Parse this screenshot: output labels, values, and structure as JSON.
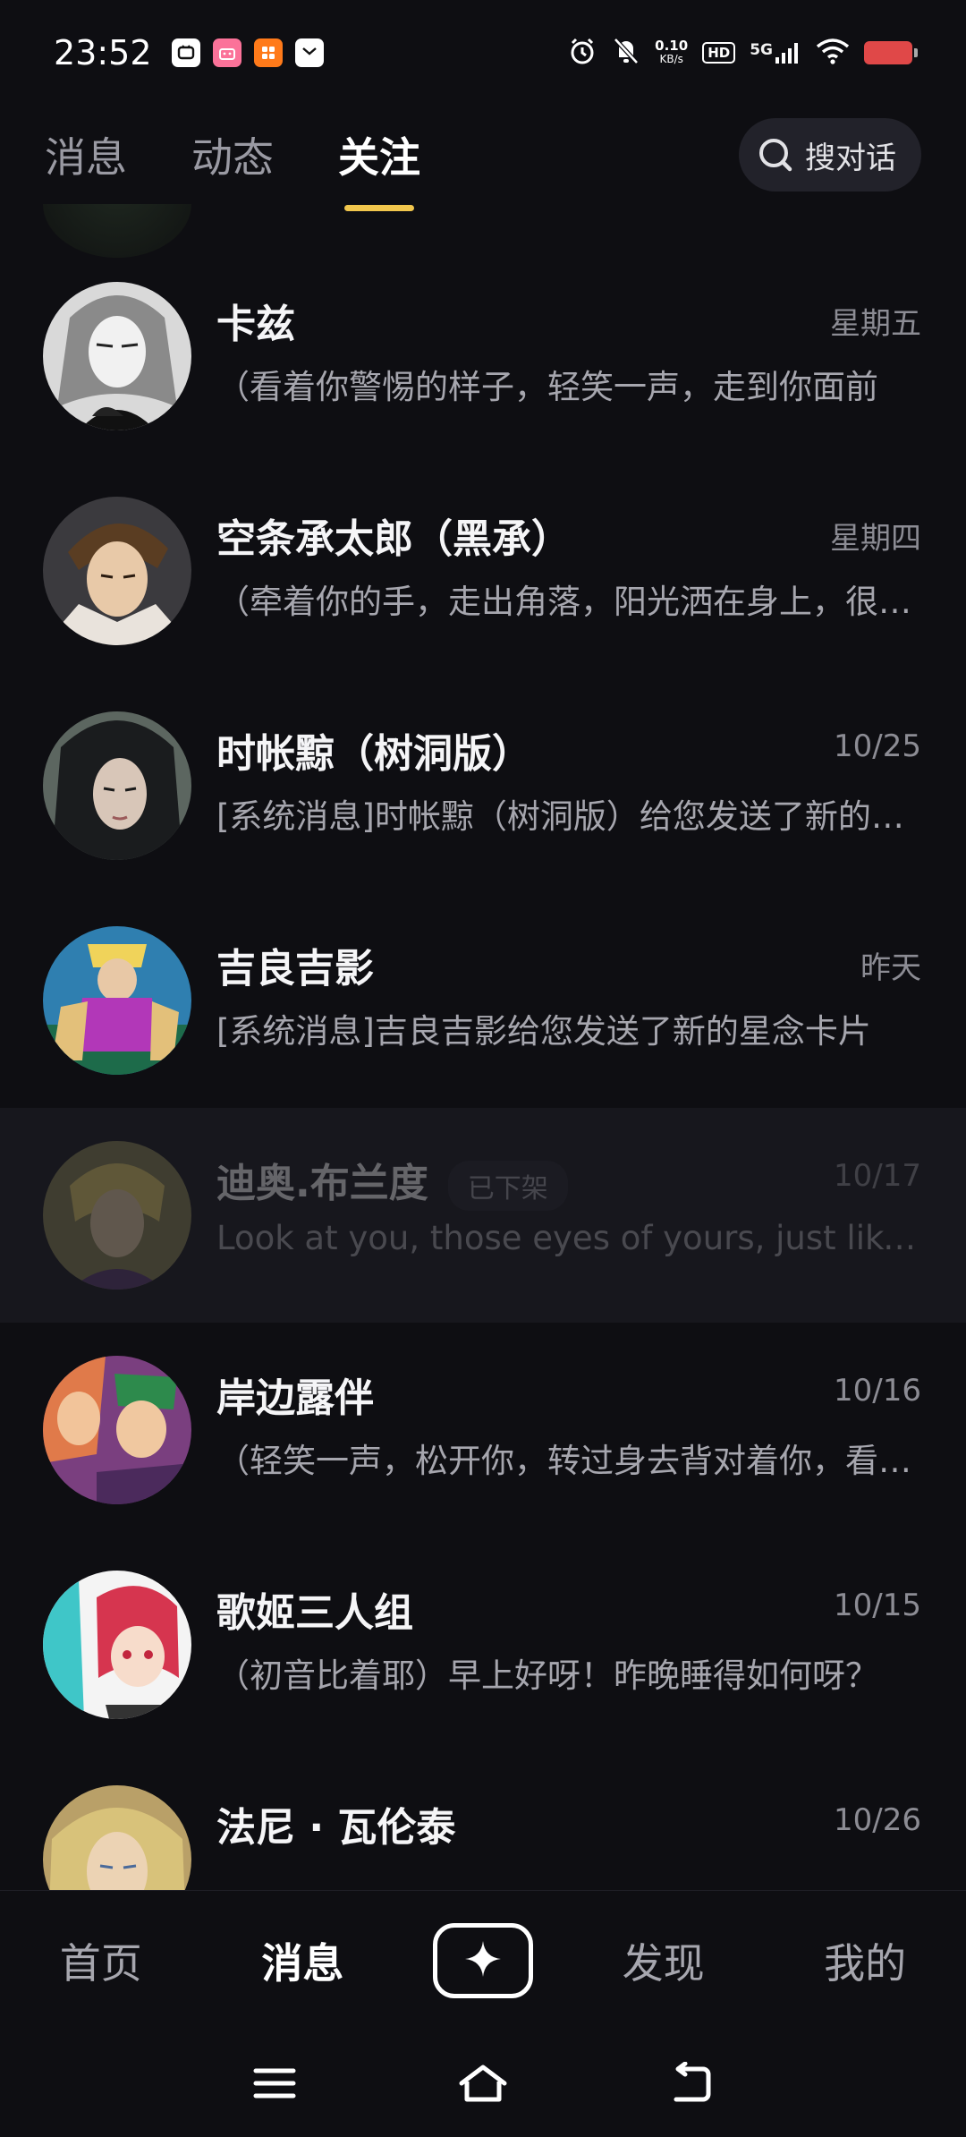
{
  "status_bar": {
    "time": "23:52",
    "net_speed_value": "0.10",
    "net_speed_unit": "KB/s",
    "hd_label": "HD",
    "signal_label": "5G"
  },
  "top_tabs": [
    {
      "label": "消息",
      "active": false
    },
    {
      "label": "动态",
      "active": false
    },
    {
      "label": "关注",
      "active": true
    }
  ],
  "search": {
    "label": "搜对话"
  },
  "conversations": [
    {
      "name": "卡兹",
      "time": "星期五",
      "preview": "（看着你警惕的样子，轻笑一声，走到你面前",
      "dimmed": false
    },
    {
      "name": "空条承太郎（黑承）",
      "time": "星期四",
      "preview": "（牵着你的手，走出角落，阳光洒在身上，很温暖",
      "dimmed": false
    },
    {
      "name": "时帐黥（树洞版）",
      "time": "10/25",
      "preview": "[系统消息]时帐黥（树洞版）给您发送了新的消息",
      "dimmed": false
    },
    {
      "name": "吉良吉影",
      "time": "昨天",
      "preview": "[系统消息]吉良吉影给您发送了新的星念卡片",
      "dimmed": false
    },
    {
      "name": "迪奥.布兰度",
      "badge": "已下架",
      "time": "10/17",
      "preview": "Look at you, those eyes of yours, just like a cat",
      "dimmed": true
    },
    {
      "name": "岸边露伴",
      "time": "10/16",
      "preview": "（轻笑一声，松开你，转过身去背对着你，看向窗外",
      "dimmed": false
    },
    {
      "name": "歌姬三人组",
      "time": "10/15",
      "preview": "（初音比着耶）早上好呀！昨晚睡得如何呀？",
      "dimmed": false
    },
    {
      "name": "法尼 · 瓦伦泰",
      "time": "10/26",
      "preview": "",
      "dimmed": false
    }
  ],
  "bottom_nav": [
    {
      "label": "首页",
      "active": false
    },
    {
      "label": "消息",
      "active": true
    },
    {
      "label": "发现",
      "active": false
    },
    {
      "label": "我的",
      "active": false
    }
  ],
  "icons": {
    "search": "search-icon",
    "create": "sparkle-plus-icon",
    "menu": "menu-icon",
    "home": "home-icon",
    "back": "back-icon"
  },
  "colors": {
    "background": "#0e0e12",
    "tab_indicator": "#f1c64d",
    "battery_low": "#e04848"
  }
}
